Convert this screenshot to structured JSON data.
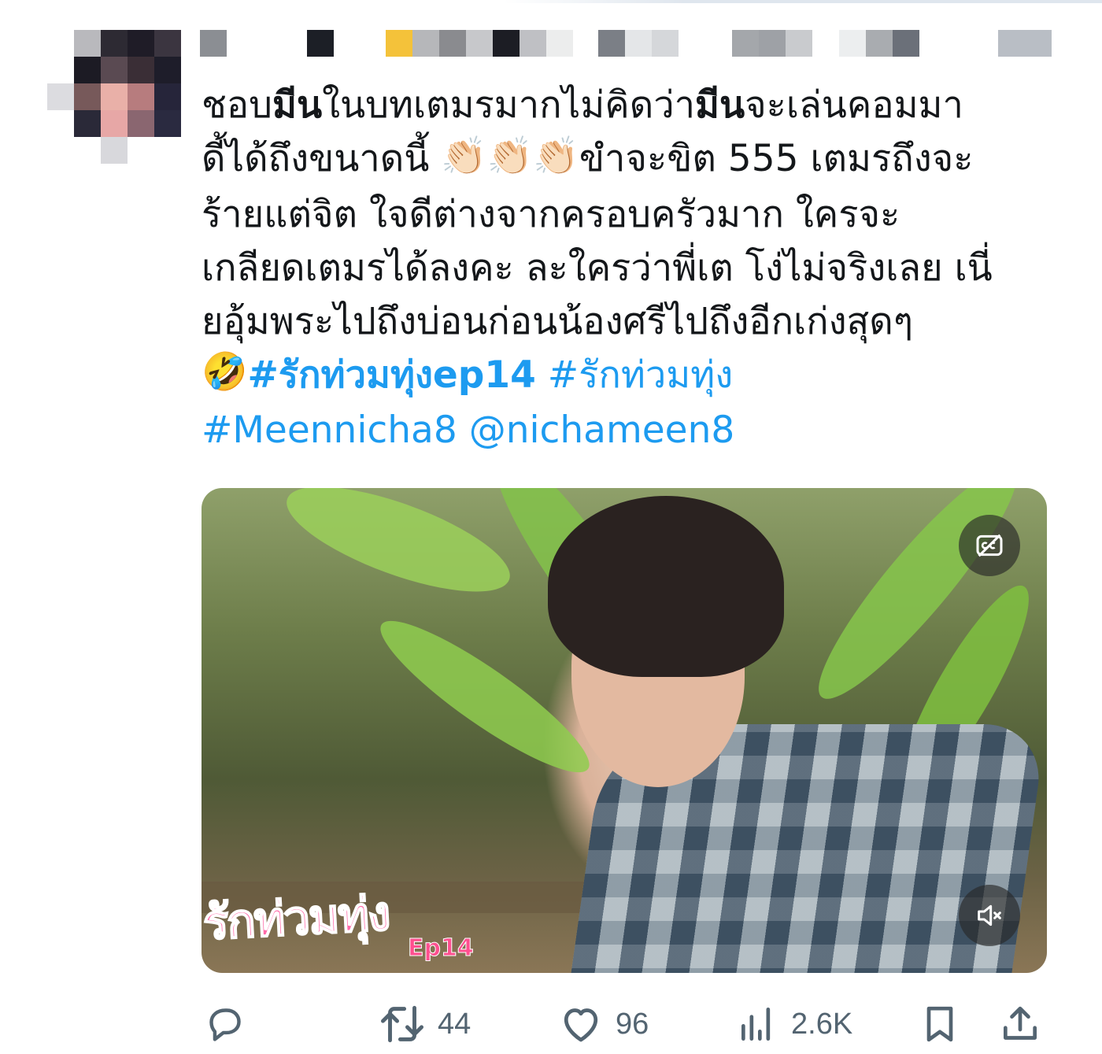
{
  "tweet": {
    "lines": [
      {
        "parts": [
          {
            "t": "ชอบ",
            "s": ""
          },
          {
            "t": "มีน",
            "s": "bold"
          },
          {
            "t": "ในบทเตมรมากไม่คิดว่า",
            "s": ""
          },
          {
            "t": "มีน",
            "s": "bold"
          },
          {
            "t": "จะเล่นคอมมา",
            "s": ""
          }
        ]
      },
      {
        "parts": [
          {
            "t": "ดี้ได้ถึงขนาดนี้ ",
            "s": ""
          },
          {
            "t": "👏🏻👏🏻👏🏻",
            "s": "emoji"
          },
          {
            "t": "ขำจะขิต 555 เตมรถึงจะ",
            "s": ""
          }
        ]
      },
      {
        "parts": [
          {
            "t": "ร้ายแต่จิต ใจดีต่างจากครอบครัวมาก ใครจะ",
            "s": ""
          }
        ]
      },
      {
        "parts": [
          {
            "t": "เกลียดเตมรได้ลงคะ ละใครว่าพี่เต โง่ไม่จริงเลย เนี่",
            "s": ""
          }
        ]
      },
      {
        "parts": [
          {
            "t": "ยอุ้มพระไปถึงบ่อนก่อนน้องศรีไปถึงอีกเก่งสุดๆ",
            "s": ""
          }
        ]
      },
      {
        "parts": [
          {
            "t": "🤣",
            "s": "emoji2"
          },
          {
            "t": "#รักท่วมทุ่งep14",
            "s": "linkbold"
          },
          {
            "t": " ",
            "s": ""
          },
          {
            "t": "#รักท่วมทุ่ง",
            "s": "link"
          }
        ]
      },
      {
        "parts": [
          {
            "t": "#Meennicha8",
            "s": "link"
          },
          {
            "t": " ",
            "s": ""
          },
          {
            "t": "@nichameen8",
            "s": "link"
          }
        ]
      }
    ]
  },
  "video": {
    "logo_text": "รักท่วมทุ่ง",
    "episode_text": "Ep14"
  },
  "actions": {
    "reply": {
      "icon": "reply-icon",
      "count": ""
    },
    "retweet": {
      "icon": "retweet-icon",
      "count": "44"
    },
    "like": {
      "icon": "heart-icon",
      "count": "96"
    },
    "views": {
      "icon": "views-icon",
      "count": "2.6K"
    },
    "bookmark": {
      "icon": "bookmark-icon",
      "count": ""
    },
    "share": {
      "icon": "share-icon",
      "count": ""
    }
  },
  "colors": {
    "link": "#1d9bf0",
    "text": "#14171a",
    "muted": "#536471"
  }
}
